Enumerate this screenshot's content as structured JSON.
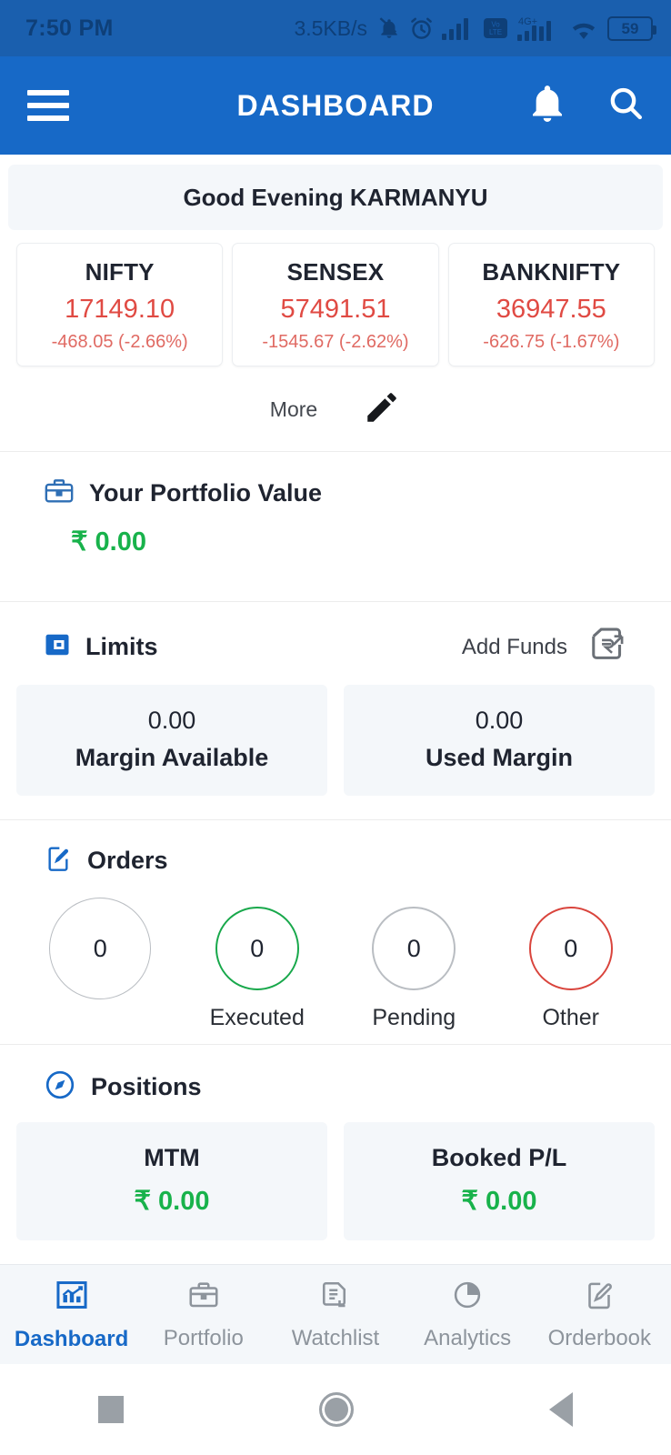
{
  "status_bar": {
    "time": "7:50 PM",
    "network_speed": "3.5KB/s",
    "battery_level": "59",
    "icons": [
      "mute-icon",
      "alarm-icon",
      "signal-icon",
      "volte-icon",
      "4g-plus-signal-icon",
      "wifi-icon",
      "battery-icon"
    ]
  },
  "app_bar": {
    "title": "DASHBOARD",
    "menu_icon": "hamburger-menu-icon",
    "notification_icon": "bell-icon",
    "search_icon": "search-icon"
  },
  "greeting": "Good Evening KARMANYU",
  "indices": [
    {
      "name": "NIFTY",
      "value": "17149.10",
      "change": "-468.05  (-2.66%)"
    },
    {
      "name": "SENSEX",
      "value": "57491.51",
      "change": "-1545.67  (-2.62%)"
    },
    {
      "name": "BANKNIFTY",
      "value": "36947.55",
      "change": "-626.75  (-1.67%)"
    }
  ],
  "more": {
    "label": "More",
    "edit_icon": "pencil-edit-icon"
  },
  "portfolio": {
    "title": "Your Portfolio Value",
    "icon": "briefcase-icon",
    "value": "₹ 0.00"
  },
  "limits": {
    "title": "Limits",
    "icon": "limits-card-icon",
    "add_funds_label": "Add Funds",
    "add_funds_icon": "add-funds-rupee-icon",
    "cards": [
      {
        "value": "0.00",
        "label": "Margin Available"
      },
      {
        "value": "0.00",
        "label": "Used Margin"
      }
    ]
  },
  "orders": {
    "title": "Orders",
    "icon": "orders-edit-document-icon",
    "items": [
      {
        "count": "0",
        "label": "",
        "color": "#b9bdc2"
      },
      {
        "count": "0",
        "label": "Executed",
        "color": "#18a84b"
      },
      {
        "count": "0",
        "label": "Pending",
        "color": "#b9bdc2"
      },
      {
        "count": "0",
        "label": "Other",
        "color": "#d9443c"
      }
    ]
  },
  "positions": {
    "title": "Positions",
    "icon": "compass-icon",
    "cards": [
      {
        "label": "MTM",
        "value": "₹ 0.00"
      },
      {
        "label": "Booked P/L",
        "value": "₹ 0.00"
      }
    ]
  },
  "bottom_nav": [
    {
      "label": "Dashboard",
      "icon": "chart-dashboard-icon",
      "active": true
    },
    {
      "label": "Portfolio",
      "icon": "briefcase-icon",
      "active": false
    },
    {
      "label": "Watchlist",
      "icon": "list-document-icon",
      "active": false
    },
    {
      "label": "Analytics",
      "icon": "pie-chart-icon",
      "active": false
    },
    {
      "label": "Orderbook",
      "icon": "edit-document-icon",
      "active": false
    }
  ],
  "system_nav": {
    "recents": "square-recents-icon",
    "home": "circle-home-icon",
    "back": "triangle-back-icon"
  },
  "colors": {
    "primary_blue": "#1769c7",
    "status_blue": "#1A5FAE",
    "negative_red": "#e04a43",
    "positive_green": "#18b24b",
    "card_bg": "#f4f7fa"
  }
}
